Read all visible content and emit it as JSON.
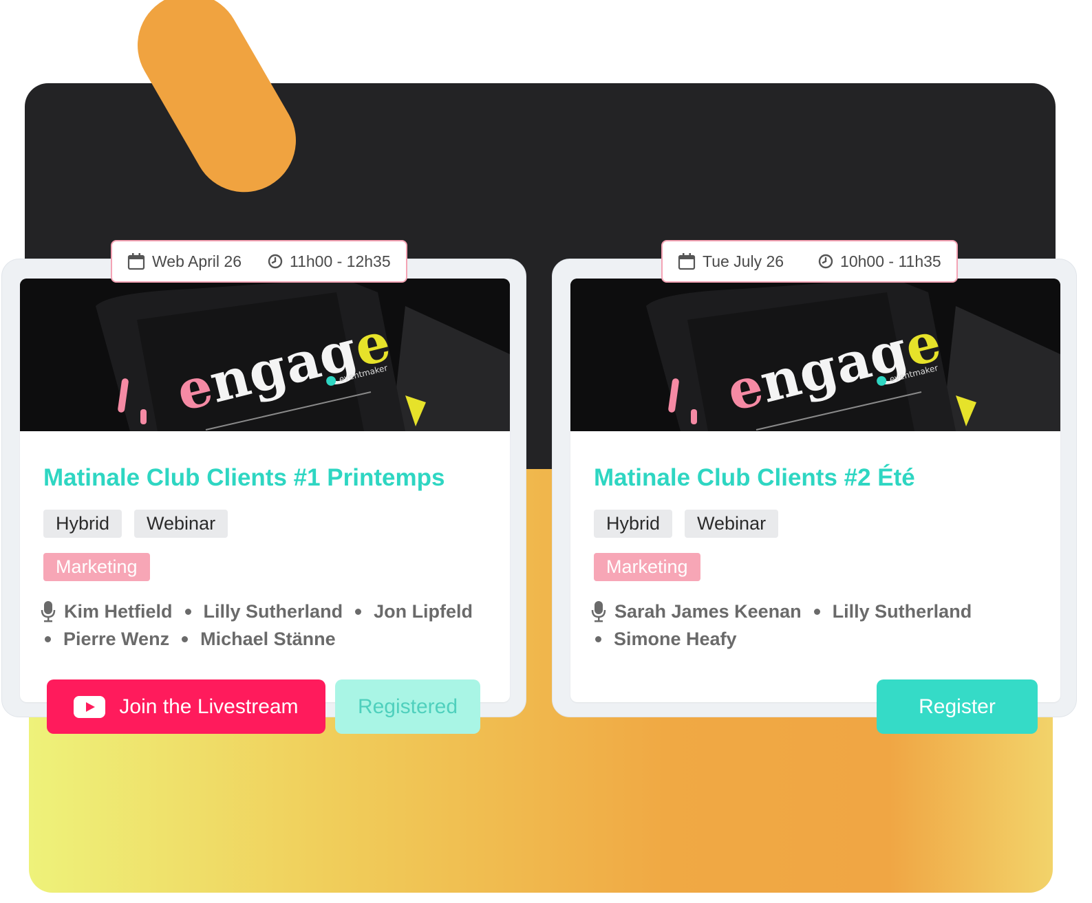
{
  "cards": [
    {
      "date": "Web April 26",
      "time": "11h00 - 12h35",
      "title": "Matinale Club Clients #1 Printemps",
      "tags": [
        "Hybrid",
        "Webinar",
        "Marketing"
      ],
      "speakers_line1": [
        "Kim Hetfield",
        "Lilly Sutherland",
        "Jon Lipfeld"
      ],
      "speakers_line2": [
        "Pierre Wenz",
        "Michael Stänne"
      ],
      "image_brand": "engage",
      "image_sub": "eventmaker"
    },
    {
      "date": "Tue July 26",
      "time": "10h00 - 11h35",
      "title": "Matinale Club Clients #2 Été",
      "tags": [
        "Hybrid",
        "Webinar",
        "Marketing"
      ],
      "speakers_line1": [
        "Sarah James Keenan",
        "Lilly Sutherland"
      ],
      "speakers_line2": [
        "Simone Heafy"
      ],
      "image_brand": "engage",
      "image_sub": "eventmaker"
    }
  ],
  "buttons": {
    "livestream": "Join the Livestream",
    "registered": "Registered",
    "register": "Register"
  },
  "colors": {
    "accent_teal": "#2ed6c2",
    "live_red": "#ff1b5c",
    "tag_pink": "#f7a6b6",
    "dark_panel": "#232325",
    "orange": "#f0a340"
  },
  "icons": [
    "calendar-icon",
    "clock-icon",
    "microphone-icon",
    "youtube-play-icon"
  ]
}
